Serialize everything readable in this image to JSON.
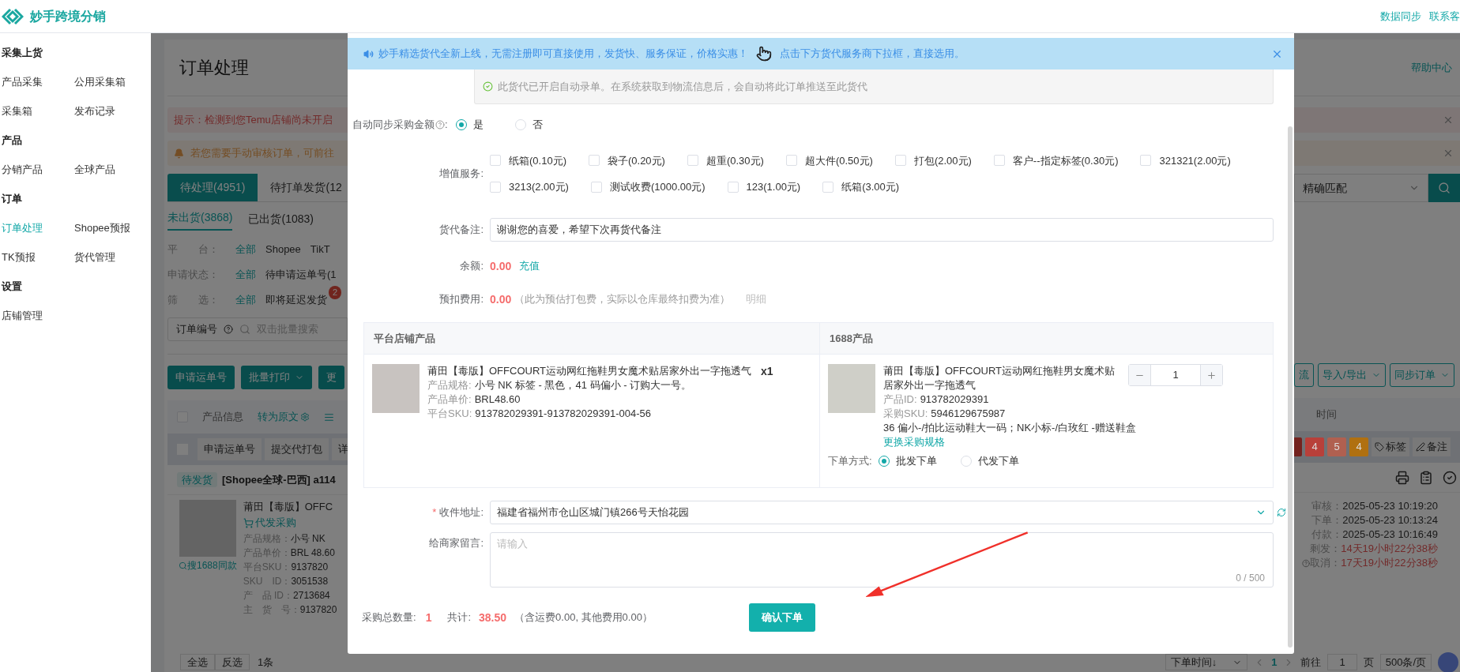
{
  "header": {
    "app_name": "妙手跨境分销",
    "links": [
      "数据同步",
      "联系客"
    ]
  },
  "sidebar": {
    "sections": [
      {
        "title": "采集上货",
        "items": [
          {
            "label": "产品采集",
            "selected": false
          },
          {
            "label": "公用采集箱",
            "selected": false
          },
          {
            "label": "采集箱",
            "selected": false
          },
          {
            "label": "发布记录",
            "selected": false
          }
        ]
      },
      {
        "title": "产品",
        "items": [
          {
            "label": "分销产品",
            "selected": false
          },
          {
            "label": "全球产品",
            "selected": false
          }
        ]
      },
      {
        "title": "订单",
        "items": [
          {
            "label": "订单处理",
            "selected": true
          },
          {
            "label": "Shopee预报",
            "selected": false
          },
          {
            "label": "TK预报",
            "selected": false
          },
          {
            "label": "货代管理",
            "selected": false
          }
        ]
      },
      {
        "title": "设置",
        "items": [
          {
            "label": "店铺管理",
            "selected": false
          }
        ]
      }
    ]
  },
  "page": {
    "title": "订单处理",
    "help_link": "帮助中心",
    "alerts": [
      {
        "kind": "error",
        "text": "提示：检测到您Temu店铺尚未开启"
      },
      {
        "kind": "warning",
        "text": "若您需要手动审核订单，可前往"
      }
    ],
    "status_tabs": [
      {
        "label": "待处理(4951)",
        "selected": true
      },
      {
        "label": "待打单发货(12",
        "selected": false
      }
    ],
    "ship_tabs": [
      {
        "label": "未出货(3868)",
        "selected": true
      },
      {
        "label": "已出货(1083)",
        "selected": false
      }
    ],
    "filters": [
      {
        "label": "平　　台：",
        "options": [
          {
            "label": "全部",
            "selected": true
          },
          {
            "label": "Shopee",
            "selected": false
          },
          {
            "label": "TikT",
            "selected": false
          }
        ]
      },
      {
        "label": "申请状态：",
        "options": [
          {
            "label": "全部",
            "selected": true
          },
          {
            "label": "待申请运单号(1",
            "selected": false
          }
        ]
      },
      {
        "label": "筛　　选：",
        "options": [
          {
            "label": "全部",
            "selected": true
          },
          {
            "label": "即将延迟发货",
            "selected": false,
            "badge": "2"
          }
        ]
      }
    ],
    "search": {
      "label": "订单编号",
      "placeholder": "双击批量搜索",
      "match": "精确匹配"
    },
    "toolbar_left": [
      {
        "label": "申请运单号",
        "dropdown": false
      },
      {
        "label": "批量打印",
        "dropdown": true
      },
      {
        "label": "更",
        "dropdown": false
      }
    ],
    "toolbar_right": [
      {
        "label": "流",
        "dropdown": false
      },
      {
        "label": "导入/导出",
        "dropdown": true
      },
      {
        "label": "同步订单",
        "dropdown": true
      }
    ],
    "table_header": {
      "checked": false,
      "product": "产品信息",
      "translate": "转为原文",
      "time": "时间"
    },
    "batch_checked": false,
    "batch_actions": [
      "申请运单号",
      "提交代打包",
      "详"
    ],
    "tag_counts": [
      {
        "text": "4",
        "color": "#b8403a"
      },
      {
        "text": "5",
        "color": "#b06050"
      },
      {
        "text": "4",
        "color": "#b07010"
      }
    ],
    "tag_actions": [
      "标签",
      "备注"
    ],
    "order": {
      "status": "待发货",
      "title": "[Shopee全球-巴西]  a114",
      "product_name": "莆田【毒版】OFFC",
      "purchase_link": "代发采购",
      "search_link": "搜1688同款",
      "details": [
        {
          "label": "产品规格：",
          "value": "小号 NK"
        },
        {
          "label": "产品单价：",
          "value": "BRL 48.60"
        },
        {
          "label": "平台SKU：",
          "value": "9137820"
        },
        {
          "label": "SKU　ID：",
          "value": "3051538"
        },
        {
          "label": "产　品 ID：",
          "value": "2713684"
        },
        {
          "label": "主　货　号：",
          "value": "9137820"
        }
      ],
      "times": [
        {
          "label": "审核：",
          "value": "2025-05-23 10:19:20",
          "kind": "normal",
          "help": false
        },
        {
          "label": "下单：",
          "value": "2025-05-23 10:13:24",
          "kind": "normal",
          "help": false
        },
        {
          "label": "付款：",
          "value": "2025-05-23 10:16:49",
          "kind": "normal",
          "help": false
        },
        {
          "label": "剩发：",
          "value": "14天19小时22分38秒",
          "kind": "warning",
          "help": false
        },
        {
          "label": "取消：",
          "value": "17天19小时22分38秒",
          "kind": "warning",
          "help": true
        }
      ]
    },
    "footer": {
      "select_all": "全选",
      "invert": "反选",
      "count": "1条",
      "sort": "下单时间↓",
      "current_page": "1",
      "goto_label": "前往",
      "goto_value": "1",
      "page_unit": "页",
      "page_size": "500条/页"
    }
  },
  "modal": {
    "notice": {
      "text": "妙手精选货代全新上线，无需注册即可直接使用，发货快、服务保证，价格实惠！",
      "hint": "点击下方货代服务商下拉框，直接选用。"
    },
    "forwarder_note": "此货代已开启自动录单。在系统获取到物流信息后，会自动将此订单推送至此货代",
    "auto_sync": {
      "label": "自动同步采购金额",
      "colon": ":",
      "options": [
        {
          "label": "是",
          "selected": true
        },
        {
          "label": "否",
          "selected": false
        }
      ]
    },
    "services": {
      "label": "增值服务:",
      "items": [
        {
          "label": "纸箱(0.10元)",
          "checked": false
        },
        {
          "label": "袋子(0.20元)",
          "checked": false
        },
        {
          "label": "超重(0.30元)",
          "checked": false
        },
        {
          "label": "超大件(0.50元)",
          "checked": false
        },
        {
          "label": "打包(2.00元)",
          "checked": false
        },
        {
          "label": "客户--指定标签(0.30元)",
          "checked": false
        },
        {
          "label": "321321(2.00元)",
          "checked": false
        },
        {
          "label": "3213(2.00元)",
          "checked": false
        },
        {
          "label": "测试收费(1000.00元)",
          "checked": false
        },
        {
          "label": "123(1.00元)",
          "checked": false
        },
        {
          "label": "纸箱(3.00元)",
          "checked": false
        }
      ]
    },
    "remark": {
      "label": "货代备注:",
      "value": "谢谢您的喜爱，希望下次再货代备注"
    },
    "balance": {
      "label": "余额:",
      "amount": "0.00",
      "link": "充值"
    },
    "prededuct": {
      "label": "预扣费用:",
      "amount": "0.00",
      "note": "（此为预估打包费，实际以仓库最终扣费为准）",
      "link": "明细"
    },
    "products": {
      "columns": [
        "平台店铺产品",
        "1688产品"
      ],
      "platform": {
        "name": "莆田【毒版】OFFCOURT运动网红拖鞋男女魔术贴居家外出一字拖透气",
        "qty": "x1",
        "fields": [
          {
            "label": "产品规格:",
            "value": "小号 NK 标签 - 黑色，41 码偏小 - 订购大一号。"
          },
          {
            "label": "产品单价:",
            "value": "BRL48.60"
          },
          {
            "label": "平台SKU:",
            "value": "913782029391-913782029391-004-56"
          }
        ]
      },
      "source": {
        "name": "莆田【毒版】OFFCOURT运动网红拖鞋男女魔术贴居家外出一字拖透气",
        "fields": [
          {
            "label": "产品ID:",
            "value": "913782029391"
          },
          {
            "label": "采购SKU:",
            "value": "5946129675987"
          }
        ],
        "spec": "36 偏小-/拍比运动鞋大一码；NK小标-/白玫红 -赠送鞋盒",
        "change_link": "更换采购规格",
        "quantity": "1",
        "order_mode": {
          "label": "下单方式:",
          "options": [
            {
              "label": "批发下单",
              "selected": true
            },
            {
              "label": "代发下单",
              "selected": false
            }
          ]
        }
      }
    },
    "address": {
      "required_mark": "*",
      "label": "收件地址:",
      "value": "福建省福州市仓山区城门镇266号天怡花园"
    },
    "message": {
      "label": "给商家留言:",
      "placeholder": "请输入",
      "counter": "0 / 500"
    },
    "summary": {
      "qty_label": "采购总数量:",
      "qty": "1",
      "total_label": "共计:",
      "total": "38.50",
      "note": "（含运费0.00, 其他费用0.00）"
    },
    "confirm": "确认下单"
  }
}
